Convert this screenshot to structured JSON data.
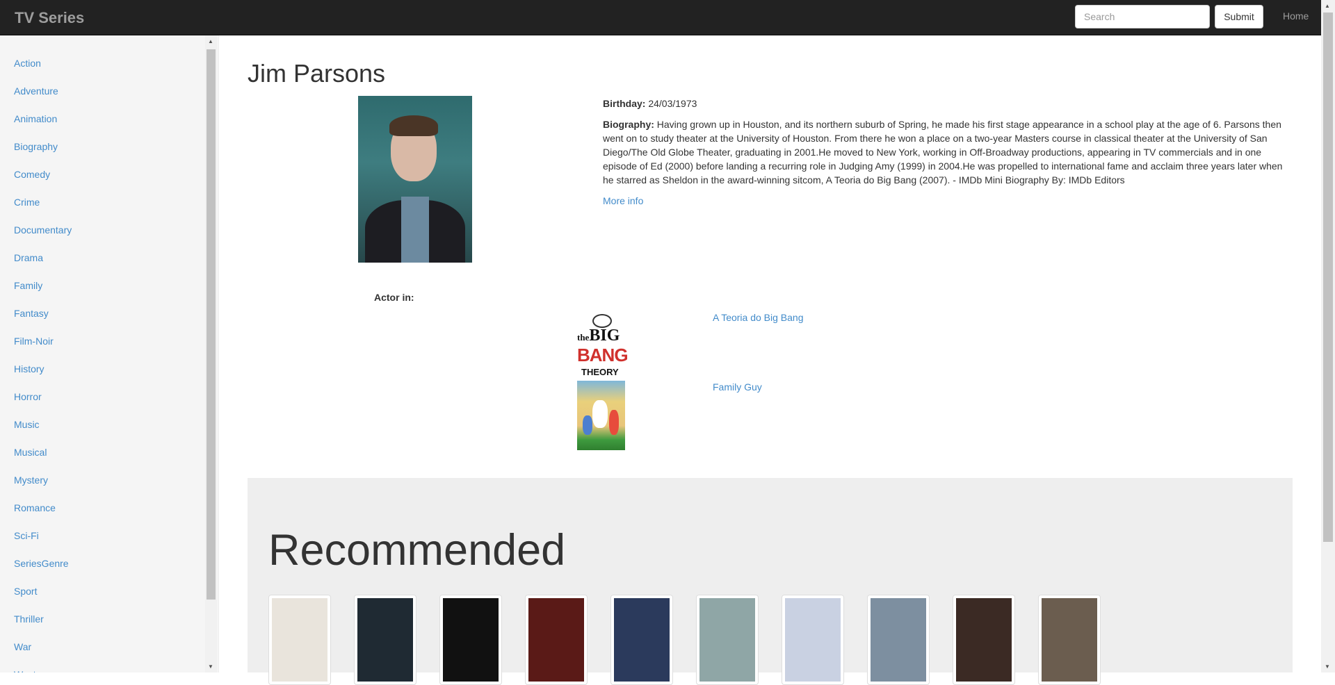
{
  "navbar": {
    "brand": "TV Series",
    "search_placeholder": "Search",
    "submit_label": "Submit",
    "home_label": "Home"
  },
  "sidebar": {
    "genres": [
      "Action",
      "Adventure",
      "Animation",
      "Biography",
      "Comedy",
      "Crime",
      "Documentary",
      "Drama",
      "Family",
      "Fantasy",
      "Film-Noir",
      "History",
      "Horror",
      "Music",
      "Musical",
      "Mystery",
      "Romance",
      "Sci-Fi",
      "SeriesGenre",
      "Sport",
      "Thriller",
      "War",
      "Western"
    ]
  },
  "person": {
    "name": "Jim Parsons",
    "birthday_label": "Birthday:",
    "birthday": "24/03/1973",
    "biography_label": "Biography:",
    "biography": "Having grown up in Houston, and its northern suburb of Spring, he made his first stage appearance in a school play at the age of 6. Parsons then went on to study theater at the University of Houston. From there he won a place on a two-year Masters course in classical theater at the University of San Diego/The Old Globe Theater, graduating in 2001.He moved to New York, working in Off-Broadway productions, appearing in TV commercials and in one episode of Ed (2000) before landing a recurring role in Judging Amy (1999) in 2004.He was propelled to international fame and acclaim three years later when he starred as Sheldon in the award-winning sitcom, A Teoria do Big Bang (2007). - IMDb Mini Biography By: IMDb Editors",
    "more_info": "More info",
    "actor_in_label": "Actor in:",
    "shows": [
      {
        "title": "A Teoria do Big Bang",
        "poster_the": "the",
        "poster_big": "BIG",
        "poster_bang": "BANG",
        "poster_theory": "THEORY"
      },
      {
        "title": "Family Guy"
      }
    ]
  },
  "recommended": {
    "heading": "Recommended",
    "items": [
      {
        "name": "fargo-poster",
        "color": "#e9e4dc"
      },
      {
        "name": "got-poster",
        "color": "#1f2a33"
      },
      {
        "name": "the-wire-poster",
        "color": "#111111"
      },
      {
        "name": "poster-4",
        "color": "#5a1a17"
      },
      {
        "name": "firefly-poster",
        "color": "#2b3a5c"
      },
      {
        "name": "breaking-bad-poster",
        "color": "#8fa6a6"
      },
      {
        "name": "placeholder-avatar",
        "color": "#c9d1e2"
      },
      {
        "name": "person-photo-1",
        "color": "#7d8fa0"
      },
      {
        "name": "person-photo-2",
        "color": "#3b2a24"
      },
      {
        "name": "person-photo-3",
        "color": "#6b5d4f"
      }
    ]
  }
}
